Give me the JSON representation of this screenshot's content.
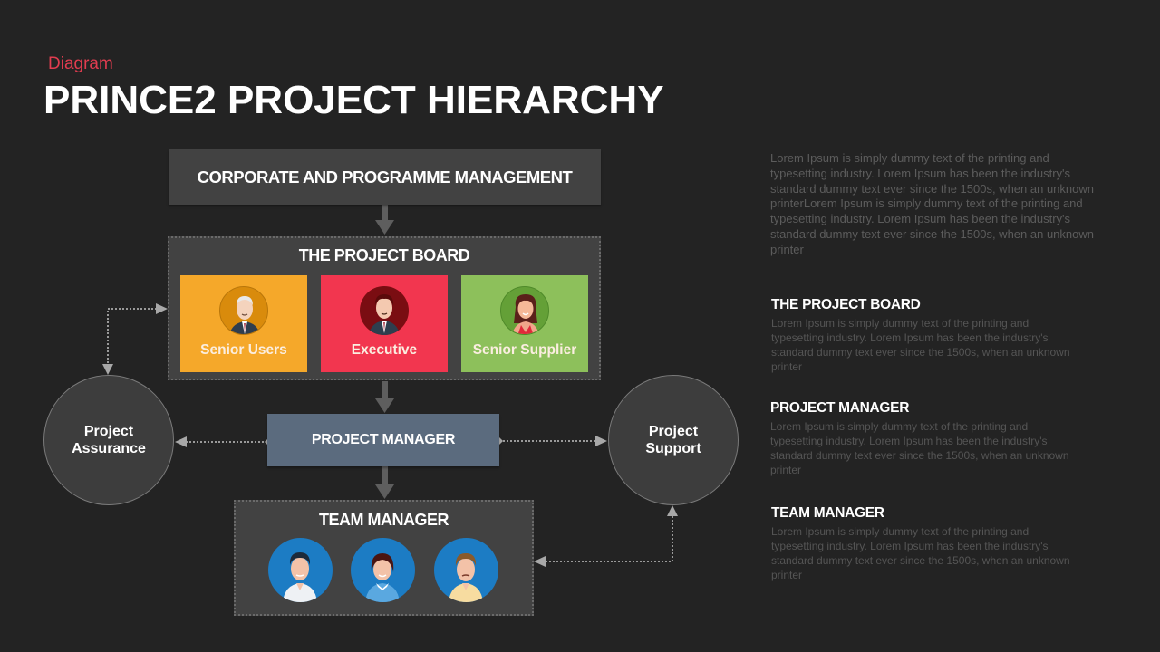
{
  "header": {
    "subtitle": "Diagram",
    "title": "PRINCE2 PROJECT HIERARCHY"
  },
  "diagram": {
    "corporate": {
      "label": "CORPORATE AND PROGRAMME MANAGEMENT"
    },
    "project_board": {
      "title": "THE PROJECT BOARD",
      "roles": [
        {
          "label": "Senior Users",
          "color": "#f5a82a",
          "avatar_bg": "#d98b0c",
          "icon": "elderly-man-avatar-icon"
        },
        {
          "label": "Executive",
          "color": "#f2364f",
          "avatar_bg": "#7a0d12",
          "icon": "businessman-avatar-icon"
        },
        {
          "label": "Senior Supplier",
          "color": "#8dc05b",
          "avatar_bg": "#64a037",
          "icon": "businesswoman-avatar-icon"
        }
      ]
    },
    "project_manager": {
      "label": "PROJECT MANAGER"
    },
    "team_manager": {
      "title": "TEAM MANAGER",
      "members": [
        {
          "icon": "male-team-member-avatar-icon"
        },
        {
          "icon": "female-team-member-avatar-icon"
        },
        {
          "icon": "male-team-member-avatar-icon"
        }
      ]
    },
    "project_assurance": {
      "line1": "Project",
      "line2": "Assurance"
    },
    "project_support": {
      "line1": "Project",
      "line2": "Support"
    }
  },
  "description": {
    "intro": "Lorem Ipsum is simply dummy text of the printing and typesetting industry. Lorem Ipsum has been the industry's standard dummy text ever since the 1500s, when an unknown printerLorem Ipsum is simply dummy text of the printing and typesetting industry. Lorem Ipsum has been the industry's standard dummy text ever since the 1500s, when an unknown printer",
    "sections": [
      {
        "heading": "THE PROJECT BOARD",
        "body": "Lorem Ipsum is simply dummy text of the printing and typesetting industry. Lorem Ipsum has been the industry's standard dummy text ever  since the 1500s, when an unknown  printer"
      },
      {
        "heading": "PROJECT MANAGER",
        "body": "Lorem Ipsum is simply dummy text of the printing and typesetting industry. Lorem Ipsum has been the industry's standard dummy text ever  since the 1500s, when an unknown  printer"
      },
      {
        "heading": "TEAM MANAGER",
        "body": "Lorem Ipsum is simply dummy text of the printing and typesetting industry. Lorem Ipsum has been the industry's standard dummy text ever  since the 1500s, when an unknown  printer"
      }
    ]
  }
}
